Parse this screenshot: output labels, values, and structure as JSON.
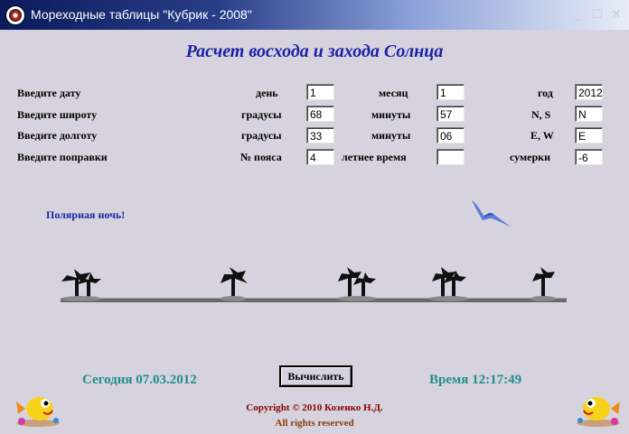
{
  "window": {
    "title": "Мореходные таблицы \"Кубрик - 2008\"",
    "minimize_glyph": "_",
    "maximize_glyph": "☐",
    "close_glyph": "✕"
  },
  "heading": "Расчет восхода и захода Солнца",
  "rows": {
    "date": {
      "label": "Введите дату",
      "f1_label": "день",
      "f1_value": "1",
      "f2_label": "месяц",
      "f2_value": "1",
      "f3_label": "год",
      "f3_value": "2012"
    },
    "lat": {
      "label": "Введите широту",
      "f1_label": "градусы",
      "f1_value": "68",
      "f2_label": "минуты",
      "f2_value": "57",
      "f3_label": "N, S",
      "f3_value": "N"
    },
    "lon": {
      "label": "Введите долготу",
      "f1_label": "градусы",
      "f1_value": "33",
      "f2_label": "минуты",
      "f2_value": "06",
      "f3_label": "E, W",
      "f3_value": "E"
    },
    "corr": {
      "label": "Введите поправки",
      "f1_label": "№ пояса",
      "f1_value": "4",
      "f2_label": "летнее время",
      "f2_value": "",
      "f3_label": "сумерки",
      "f3_value": "-6"
    }
  },
  "result": "Полярная ночь!",
  "footer": {
    "today": "Сегодня 07.03.2012",
    "time": "Время 12:17:49",
    "calculate": "Вычислить",
    "copyright": "Copyright © 2010 Козенко Н.Д.",
    "rights": "All rights reserved"
  },
  "colors": {
    "heading": "#1b22a8",
    "footer_teal": "#1f8f8a",
    "copyright": "#8b0000",
    "background": "#d6d3de"
  },
  "icons": [
    "app-icon",
    "seagull-icon",
    "palm-tree-icon",
    "cartoon-fish-icon"
  ]
}
